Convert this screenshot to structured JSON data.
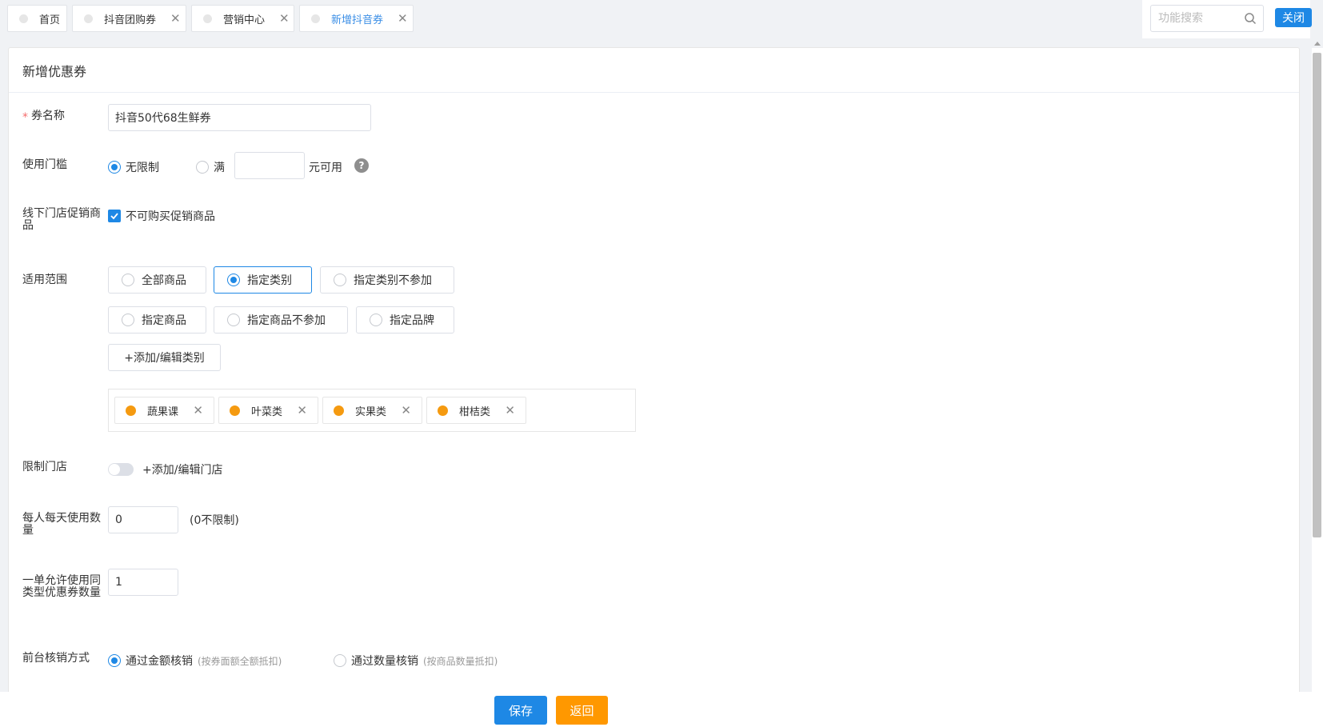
{
  "tabs": [
    {
      "label": "首页",
      "closable": false,
      "active": false
    },
    {
      "label": "抖音团购券",
      "closable": true,
      "active": false
    },
    {
      "label": "营销中心",
      "closable": true,
      "active": false
    },
    {
      "label": "新增抖音券",
      "closable": true,
      "active": true
    }
  ],
  "search": {
    "placeholder": "功能搜索"
  },
  "close_all_label": "关闭",
  "card_title": "新增优惠券",
  "form": {
    "name": {
      "label": "券名称",
      "value": "抖音50代68生鲜券"
    },
    "threshold": {
      "label": "使用门槛",
      "option_unlimited": "无限制",
      "option_full": "满",
      "suffix": "元可用",
      "selected": "unlimited",
      "amount_value": ""
    },
    "offline_promo": {
      "label": "线下门店促销商品",
      "checkbox_label": "不可购买促销商品",
      "checked": true
    },
    "scope": {
      "label": "适用范围",
      "options": [
        "全部商品",
        "指定类别",
        "指定类别不参加",
        "指定商品",
        "指定商品不参加",
        "指定品牌"
      ],
      "selected": "指定类别",
      "add_button": "+添加/编辑类别",
      "tags": [
        "蔬果课",
        "叶菜类",
        "实果类",
        "柑桔类"
      ]
    },
    "store_limit": {
      "label": "限制门店",
      "link": "+添加/编辑门店",
      "enabled": false
    },
    "daily_limit": {
      "label": "每人每天使用数量",
      "value": "0",
      "hint": "(0不限制)"
    },
    "per_order": {
      "label": "一单允许使用同类型优惠券数量",
      "value": "1"
    },
    "verify": {
      "label": "前台核销方式",
      "option_amount": "通过金额核销",
      "option_amount_hint": "(按券面额全额抵扣)",
      "option_quantity": "通过数量核销",
      "option_quantity_hint": "(按商品数量抵扣)",
      "selected": "amount"
    }
  },
  "footer": {
    "save": "保存",
    "back": "返回"
  },
  "colors": {
    "primary": "#1e88e5",
    "warning": "#ff9800",
    "tag_dot": "#f59a10",
    "required": "#f56c6c"
  }
}
